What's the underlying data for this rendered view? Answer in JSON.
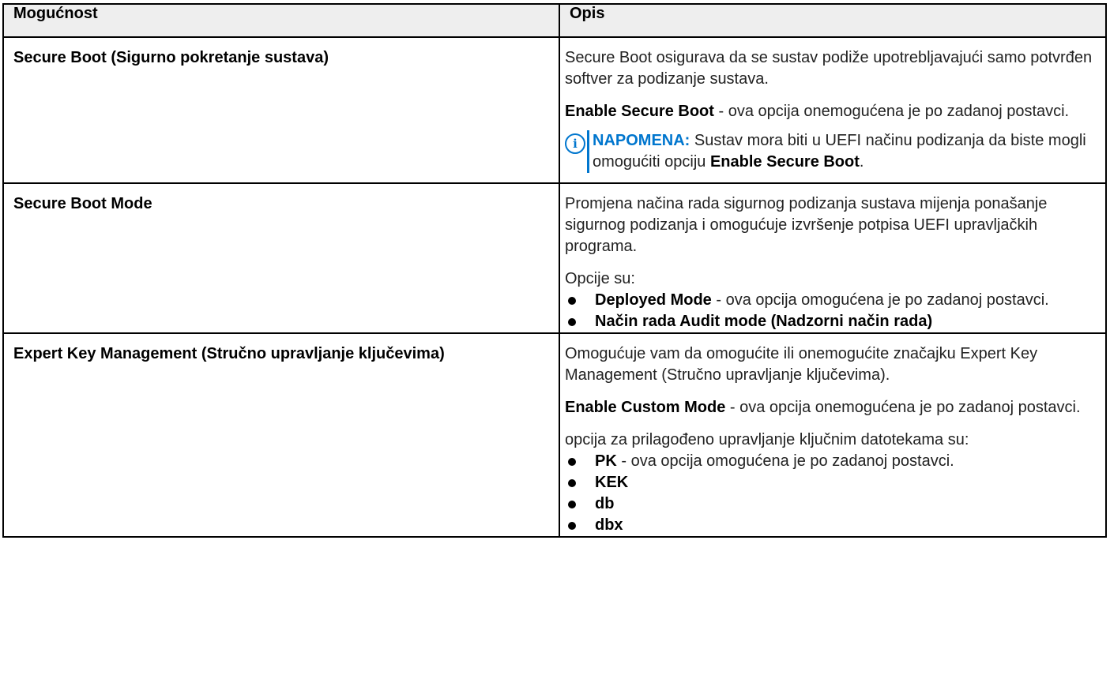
{
  "table": {
    "headers": [
      "Mogućnost",
      "Opis"
    ],
    "row1": {
      "feature": "Secure Boot (Sigurno pokretanje sustava)",
      "p1": "Secure Boot osigurava da se sustav podiže upotrebljavajući samo potvrđen softver za podizanje sustava.",
      "p2_bold": "Enable Secure Boot",
      "p2_rest": " - ova opcija onemogućena je po zadanoj postavci.",
      "note_label": "NAPOMENA:",
      "note_text": " Sustav mora biti u UEFI načinu podizanja da biste mogli omogućiti opciju ",
      "note_bold": "Enable Secure Boot",
      "note_end": "."
    },
    "row2": {
      "feature": "Secure Boot Mode",
      "p1": "Promjena načina rada sigurnog podizanja sustava mijenja ponašanje sigurnog podizanja i omogućuje izvršenje potpisa UEFI upravljačkih programa.",
      "label": "Opcije su:",
      "opt1_bold": "Deployed Mode",
      "opt1_rest": " - ova opcija omogućena je po zadanoj postavci.",
      "opt2_bold": "Način rada Audit mode (Nadzorni način rada)"
    },
    "row3": {
      "feature": "Expert Key Management (Stručno upravljanje ključevima)",
      "p1": "Omogućuje vam da omogućite ili onemogućite značajku Expert Key Management (Stručno upravljanje ključevima).",
      "p2_bold": "Enable Custom Mode",
      "p2_rest": " - ova opcija onemogućena je po zadanoj postavci.",
      "label": "opcija za prilagođeno upravljanje ključnim datotekama su:",
      "opt1_bold": "PK",
      "opt1_rest": " - ova opcija omogućena je po zadanoj postavci.",
      "opt2_bold": "KEK",
      "opt3_bold": "db",
      "opt4_bold": "dbx"
    }
  },
  "icons": {
    "note": "info-icon",
    "note_glyph": "i"
  },
  "colors": {
    "accent": "#0076ce",
    "header_bg": "#eeeeee",
    "border": "#000000"
  }
}
